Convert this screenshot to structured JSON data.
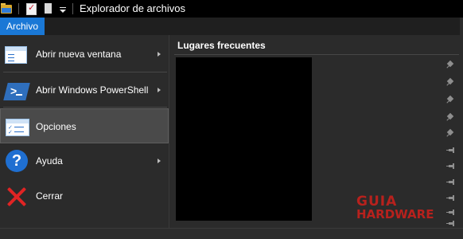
{
  "window": {
    "title": "Explorador de archivos"
  },
  "ribbon": {
    "file_tab": "Archivo"
  },
  "file_menu": {
    "items": [
      {
        "label": "Abrir nueva ventana",
        "icon": "new-window-icon",
        "has_submenu": true
      },
      {
        "label": "Abrir Windows PowerShell",
        "icon": "powershell-icon",
        "has_submenu": true
      },
      {
        "label": "Opciones",
        "icon": "options-icon",
        "has_submenu": false,
        "selected": true
      },
      {
        "label": "Ayuda",
        "icon": "help-icon",
        "has_submenu": true
      },
      {
        "label": "Cerrar",
        "icon": "close-icon",
        "has_submenu": false
      }
    ]
  },
  "frequent_places": {
    "title": "Lugares frecuentes",
    "pins": [
      "pinned",
      "pinned",
      "pinned",
      "pinned",
      "pinned",
      "unpinned",
      "unpinned",
      "unpinned",
      "unpinned",
      "unpinned",
      "unpinned"
    ]
  },
  "watermark": {
    "line1": "GUIA",
    "line2": "HARDWARE"
  },
  "colors": {
    "accent": "#1a78d6",
    "menu_bg": "#2b2b2b",
    "selected_bg": "#4a4a4a",
    "titlebar_bg": "#000000",
    "watermark": "#b7211d"
  }
}
